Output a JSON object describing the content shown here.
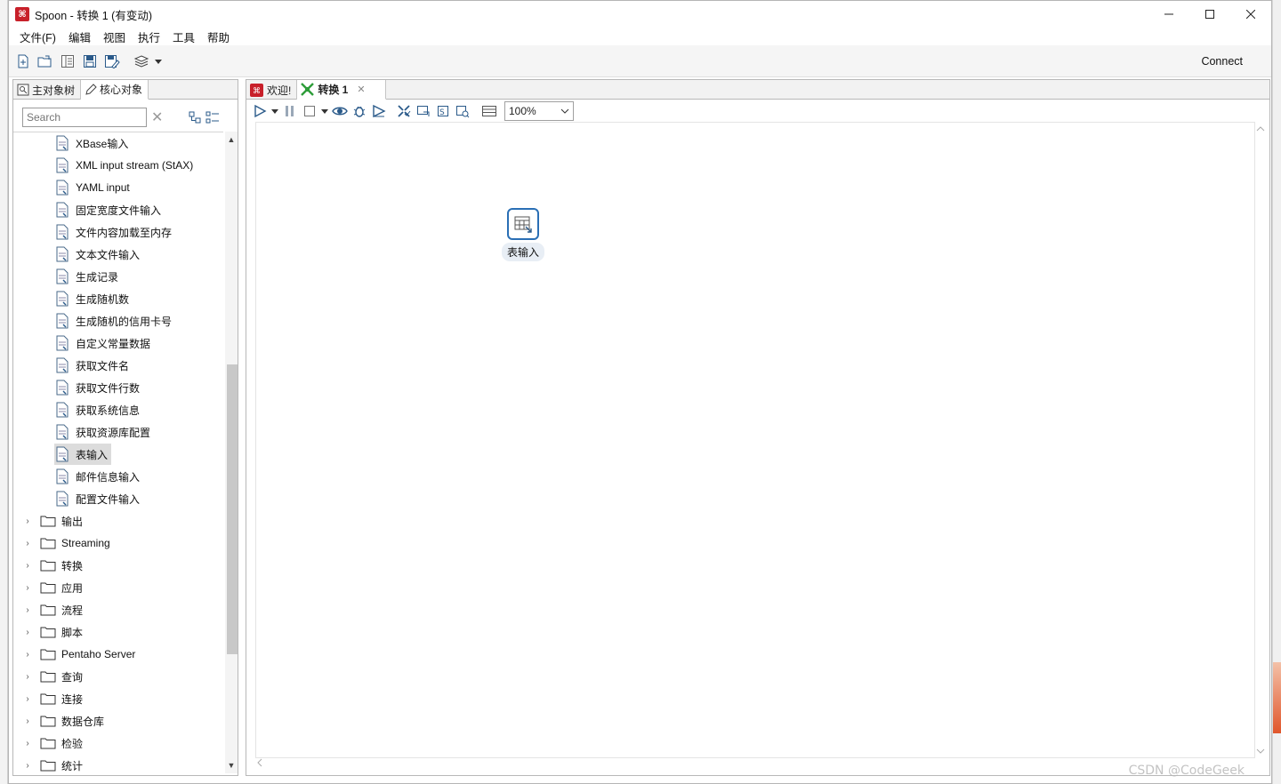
{
  "window": {
    "title": "Spoon - 转换 1 (有变动)",
    "app_icon": "kettle-icon",
    "controls": [
      "minimize-icon",
      "maximize-icon",
      "close-icon"
    ]
  },
  "menu": [
    "文件(F)",
    "编辑",
    "视图",
    "执行",
    "工具",
    "帮助"
  ],
  "toolbar": {
    "buttons": [
      "new-file-icon",
      "open-file-icon",
      "explore-repository-icon",
      "save-icon",
      "save-as-icon",
      "perspective-layers-icon"
    ],
    "connect_label": "Connect"
  },
  "left_panel": {
    "tabs": [
      {
        "label": "主对象树",
        "icon": "tree-icon"
      },
      {
        "label": "核心对象",
        "icon": "pencil-icon"
      }
    ],
    "search_placeholder": "Search",
    "leaf_items": [
      {
        "label": "XBase输入",
        "icon": "xbase-input-icon"
      },
      {
        "label": "XML input stream (StAX)",
        "icon": "xml-input-icon"
      },
      {
        "label": "YAML input",
        "icon": "yaml-input-icon"
      },
      {
        "label": "固定宽度文件输入",
        "icon": "fixed-file-input-icon"
      },
      {
        "label": "文件内容加载至内存",
        "icon": "load-file-icon"
      },
      {
        "label": "文本文件输入",
        "icon": "text-file-input-icon"
      },
      {
        "label": "生成记录",
        "icon": "generate-rows-icon"
      },
      {
        "label": "生成随机数",
        "icon": "random-value-icon"
      },
      {
        "label": "生成随机的信用卡号",
        "icon": "credit-card-icon"
      },
      {
        "label": "自定义常量数据",
        "icon": "data-grid-icon"
      },
      {
        "label": "获取文件名",
        "icon": "get-filenames-icon"
      },
      {
        "label": "获取文件行数",
        "icon": "file-rows-count-icon"
      },
      {
        "label": "获取系统信息",
        "icon": "system-info-icon"
      },
      {
        "label": "获取资源库配置",
        "icon": "repository-config-icon"
      },
      {
        "label": "表输入",
        "icon": "table-input-icon",
        "selected": true
      },
      {
        "label": "邮件信息输入",
        "icon": "email-input-icon"
      },
      {
        "label": "配置文件输入",
        "icon": "property-input-icon"
      }
    ],
    "folders": [
      "输出",
      "Streaming",
      "转换",
      "应用",
      "流程",
      "脚本",
      "Pentaho Server",
      "查询",
      "连接",
      "数据仓库",
      "检验",
      "统计"
    ]
  },
  "editor": {
    "tabs": [
      {
        "label": "欢迎!",
        "icon": "kettle-icon"
      },
      {
        "label": "转换 1",
        "icon": "transformation-icon",
        "active": true
      }
    ],
    "zoom": "100%",
    "step": {
      "label": "表输入",
      "icon": "table-input-icon"
    }
  },
  "watermark": "CSDN @CodeGeek"
}
